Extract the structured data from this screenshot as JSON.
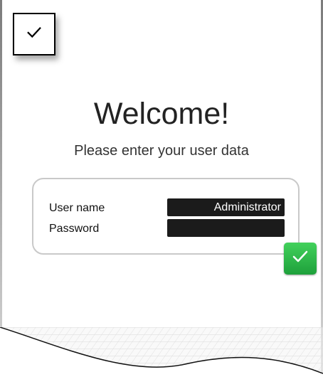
{
  "header": {
    "top_button_icon": "check-icon"
  },
  "welcome": {
    "title": "Welcome!",
    "subtitle": "Please enter your user data"
  },
  "login": {
    "username_label": "User name",
    "password_label": "Password",
    "username_value": "Administrator",
    "password_value": ""
  },
  "actions": {
    "confirm_icon": "check-icon",
    "confirm_color": "#2db84a"
  },
  "colors": {
    "input_bg": "#1b1b1b",
    "panel_border": "#c9c9c9"
  }
}
